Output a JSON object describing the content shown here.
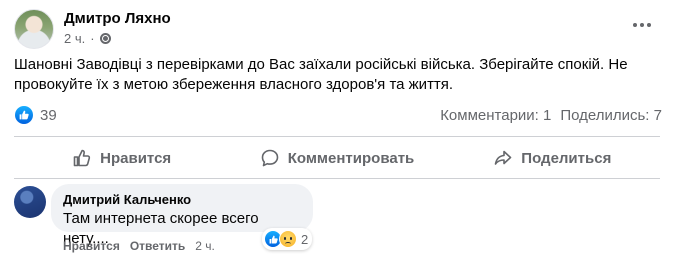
{
  "post": {
    "author": "Дмитро Ляхно",
    "time": "2 ч.",
    "separator": "·",
    "text": "Шановні Заводівці з перевірками до Вас заїхали російські війська. Зберігайте спокій. Не провокуйте їх з метою збереження власного здоров'я та життя.",
    "likes_count": "39",
    "comments_label": "Комментарии: 1",
    "shares_label": "Поделились: 7"
  },
  "actions": {
    "like": "Нравится",
    "comment": "Комментировать",
    "share": "Поделиться"
  },
  "comment": {
    "author": "Дмитрий Кальченко",
    "text": "Там интернета скорее всего нету....",
    "reactions_count": "2",
    "like_link": "Нравится",
    "reply_link": "Ответить",
    "time": "2 ч."
  },
  "colors": {
    "facebook_blue": "#1877f2",
    "secondary_text": "#65676b",
    "bubble_bg": "#f0f2f5"
  },
  "icons": [
    "globe-icon",
    "more-options-icon",
    "like-reaction-icon",
    "thumbs-up-icon",
    "comment-icon",
    "share-icon",
    "sad-reaction-icon"
  ]
}
